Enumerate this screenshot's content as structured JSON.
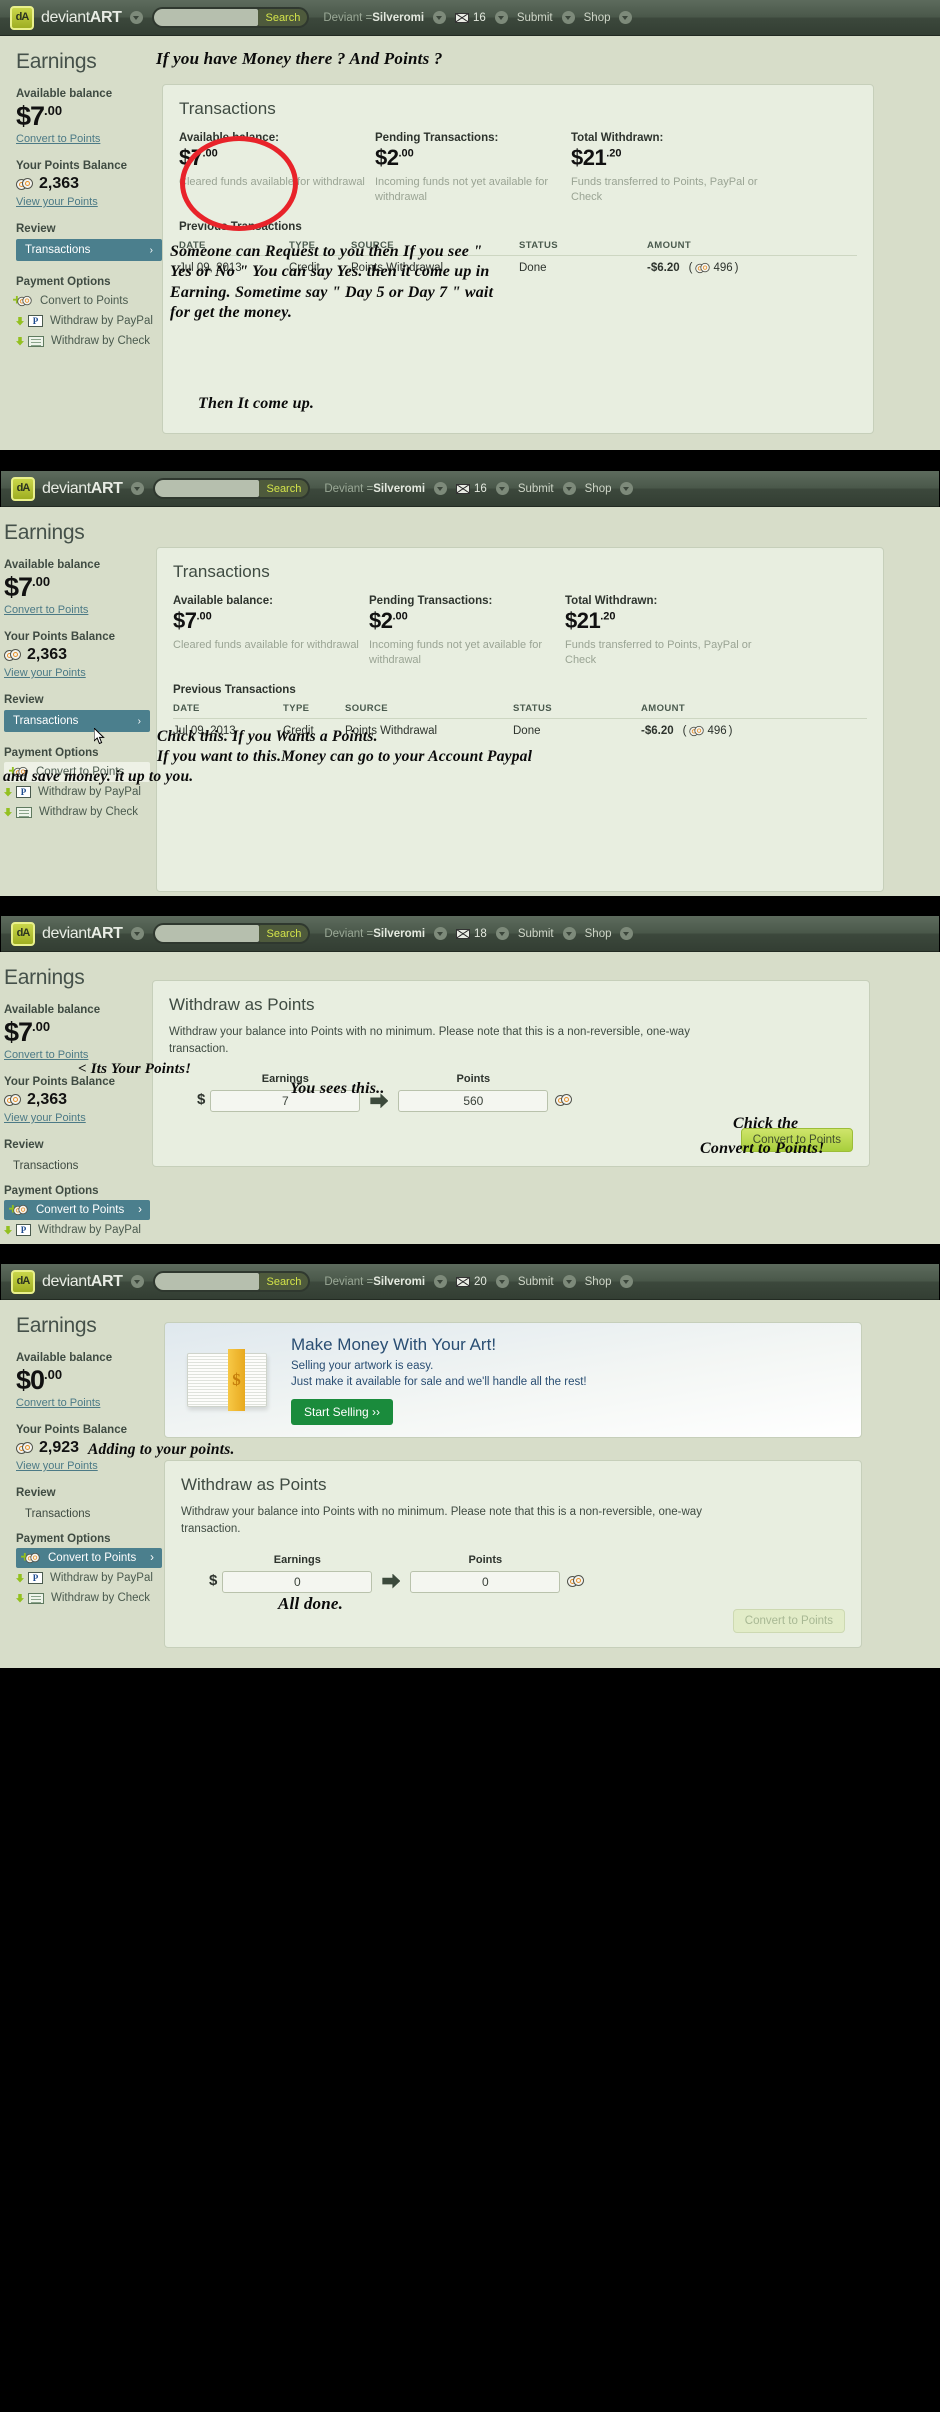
{
  "nav": {
    "logo_thin": "deviant",
    "logo_bold": "ART",
    "logo_glyph": "dA",
    "search_placeholder": "",
    "search_value": "",
    "search_button": "Search",
    "deviant_prefix": "Deviant =",
    "deviant_name": "Silveromi",
    "submit": "Submit",
    "shop": "Shop",
    "mail_counts": [
      "16",
      "16",
      "18",
      "20"
    ]
  },
  "sidebar": {
    "title": "Earnings",
    "available_label": "Available balance",
    "convert_link": "Convert to Points",
    "points_label": "Your Points Balance",
    "view_points_link": "View your Points",
    "review_label": "Review",
    "transactions_label": "Transactions",
    "chevron": "›",
    "payment_label": "Payment Options",
    "pay_convert": "Convert to Points",
    "pay_paypal": "Withdraw by PayPal",
    "pay_check": "Withdraw by Check",
    "balance_7": "$7",
    "balance_7_cents": ".00",
    "balance_0": "$0",
    "balance_0_cents": ".00",
    "points_2363": "2,363",
    "points_2923": "2,923"
  },
  "transactions_card": {
    "title": "Transactions",
    "stats": [
      {
        "label": "Available balance:",
        "value": "$7",
        "cents": ".00",
        "note": "Cleared funds available for withdrawal"
      },
      {
        "label": "Pending Transactions:",
        "value": "$2",
        "cents": ".00",
        "note": "Incoming funds not yet available for withdrawal"
      },
      {
        "label": "Total Withdrawn:",
        "value": "$21",
        "cents": ".20",
        "note": "Funds transferred to Points, PayPal or Check"
      }
    ],
    "previous_title": "Previous Transactions",
    "columns": [
      "DATE",
      "TYPE",
      "SOURCE",
      "STATUS",
      "AMOUNT"
    ],
    "rows": [
      {
        "date": "Jul 09, 2013",
        "type": "Credit",
        "source": "Points Withdrawal",
        "status": "Done",
        "amount": "-$6.20",
        "points": "496"
      }
    ]
  },
  "withdraw_card": {
    "title": "Withdraw as Points",
    "description": "Withdraw your balance into Points with no minimum. Please note that this is a non-reversible, one-way transaction.",
    "earnings_label": "Earnings",
    "points_label": "Points",
    "dollar_sign": "$",
    "button_label": "Convert to Points",
    "panel3": {
      "earnings_value": "7",
      "points_value": "560"
    },
    "panel4": {
      "earnings_value": "0",
      "points_value": "0"
    }
  },
  "promo": {
    "heading": "Make Money With Your Art!",
    "line1": "Selling your artwork is easy.",
    "line2": "Just make it available for sale and we'll handle all the rest!",
    "button": "Start Selling ››",
    "money_symbol": "$"
  },
  "annotations": {
    "p1_top": "If you have Money there ?  And Points ?",
    "p1_mid": "Someone can Request to you then If you see \"\nYes or No \" You can say Yes. then it come up in\nEarning. Sometime say \" Day 5 or Day 7 \" wait\nfor get the money.",
    "p1_bottom": "Then It come up.",
    "p2_line1": "Chick this. If you Wants a Points.",
    "p2_line2": "If you want to this.Money can go to your Account Paypal",
    "p2_line3": "and save money. it up to you.",
    "p3_points": "< Its Your Points!",
    "p3_sees": "You sees this..",
    "p3_click1": "Chick the",
    "p3_click2": "Convert to Points!",
    "p4_adding": "Adding to your points.",
    "p4_done": "All done."
  },
  "colors": {
    "nav_bar": "#4a584a",
    "page_bg": "#d7ddc9",
    "card_bg": "#e8eee0",
    "accent_teal": "#4b7f8d",
    "highlight_red": "#e8232a",
    "green_button": "#a8cf3c",
    "promo_blue": "#2a4e73",
    "sell_green": "#1a8b3c"
  }
}
